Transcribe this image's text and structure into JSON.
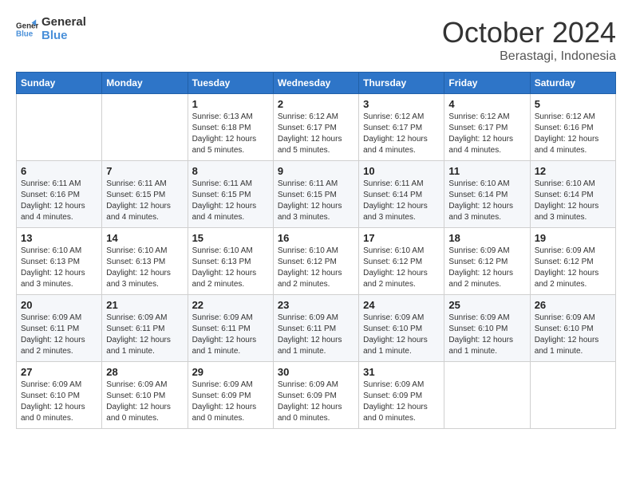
{
  "logo": {
    "line1": "General",
    "line2": "Blue"
  },
  "title": "October 2024",
  "location": "Berastagi, Indonesia",
  "days_of_week": [
    "Sunday",
    "Monday",
    "Tuesday",
    "Wednesday",
    "Thursday",
    "Friday",
    "Saturday"
  ],
  "weeks": [
    [
      {
        "day": "",
        "info": ""
      },
      {
        "day": "",
        "info": ""
      },
      {
        "day": "1",
        "info": "Sunrise: 6:13 AM\nSunset: 6:18 PM\nDaylight: 12 hours\nand 5 minutes."
      },
      {
        "day": "2",
        "info": "Sunrise: 6:12 AM\nSunset: 6:17 PM\nDaylight: 12 hours\nand 5 minutes."
      },
      {
        "day": "3",
        "info": "Sunrise: 6:12 AM\nSunset: 6:17 PM\nDaylight: 12 hours\nand 4 minutes."
      },
      {
        "day": "4",
        "info": "Sunrise: 6:12 AM\nSunset: 6:17 PM\nDaylight: 12 hours\nand 4 minutes."
      },
      {
        "day": "5",
        "info": "Sunrise: 6:12 AM\nSunset: 6:16 PM\nDaylight: 12 hours\nand 4 minutes."
      }
    ],
    [
      {
        "day": "6",
        "info": "Sunrise: 6:11 AM\nSunset: 6:16 PM\nDaylight: 12 hours\nand 4 minutes."
      },
      {
        "day": "7",
        "info": "Sunrise: 6:11 AM\nSunset: 6:15 PM\nDaylight: 12 hours\nand 4 minutes."
      },
      {
        "day": "8",
        "info": "Sunrise: 6:11 AM\nSunset: 6:15 PM\nDaylight: 12 hours\nand 4 minutes."
      },
      {
        "day": "9",
        "info": "Sunrise: 6:11 AM\nSunset: 6:15 PM\nDaylight: 12 hours\nand 3 minutes."
      },
      {
        "day": "10",
        "info": "Sunrise: 6:11 AM\nSunset: 6:14 PM\nDaylight: 12 hours\nand 3 minutes."
      },
      {
        "day": "11",
        "info": "Sunrise: 6:10 AM\nSunset: 6:14 PM\nDaylight: 12 hours\nand 3 minutes."
      },
      {
        "day": "12",
        "info": "Sunrise: 6:10 AM\nSunset: 6:14 PM\nDaylight: 12 hours\nand 3 minutes."
      }
    ],
    [
      {
        "day": "13",
        "info": "Sunrise: 6:10 AM\nSunset: 6:13 PM\nDaylight: 12 hours\nand 3 minutes."
      },
      {
        "day": "14",
        "info": "Sunrise: 6:10 AM\nSunset: 6:13 PM\nDaylight: 12 hours\nand 3 minutes."
      },
      {
        "day": "15",
        "info": "Sunrise: 6:10 AM\nSunset: 6:13 PM\nDaylight: 12 hours\nand 2 minutes."
      },
      {
        "day": "16",
        "info": "Sunrise: 6:10 AM\nSunset: 6:12 PM\nDaylight: 12 hours\nand 2 minutes."
      },
      {
        "day": "17",
        "info": "Sunrise: 6:10 AM\nSunset: 6:12 PM\nDaylight: 12 hours\nand 2 minutes."
      },
      {
        "day": "18",
        "info": "Sunrise: 6:09 AM\nSunset: 6:12 PM\nDaylight: 12 hours\nand 2 minutes."
      },
      {
        "day": "19",
        "info": "Sunrise: 6:09 AM\nSunset: 6:12 PM\nDaylight: 12 hours\nand 2 minutes."
      }
    ],
    [
      {
        "day": "20",
        "info": "Sunrise: 6:09 AM\nSunset: 6:11 PM\nDaylight: 12 hours\nand 2 minutes."
      },
      {
        "day": "21",
        "info": "Sunrise: 6:09 AM\nSunset: 6:11 PM\nDaylight: 12 hours\nand 1 minute."
      },
      {
        "day": "22",
        "info": "Sunrise: 6:09 AM\nSunset: 6:11 PM\nDaylight: 12 hours\nand 1 minute."
      },
      {
        "day": "23",
        "info": "Sunrise: 6:09 AM\nSunset: 6:11 PM\nDaylight: 12 hours\nand 1 minute."
      },
      {
        "day": "24",
        "info": "Sunrise: 6:09 AM\nSunset: 6:10 PM\nDaylight: 12 hours\nand 1 minute."
      },
      {
        "day": "25",
        "info": "Sunrise: 6:09 AM\nSunset: 6:10 PM\nDaylight: 12 hours\nand 1 minute."
      },
      {
        "day": "26",
        "info": "Sunrise: 6:09 AM\nSunset: 6:10 PM\nDaylight: 12 hours\nand 1 minute."
      }
    ],
    [
      {
        "day": "27",
        "info": "Sunrise: 6:09 AM\nSunset: 6:10 PM\nDaylight: 12 hours\nand 0 minutes."
      },
      {
        "day": "28",
        "info": "Sunrise: 6:09 AM\nSunset: 6:10 PM\nDaylight: 12 hours\nand 0 minutes."
      },
      {
        "day": "29",
        "info": "Sunrise: 6:09 AM\nSunset: 6:09 PM\nDaylight: 12 hours\nand 0 minutes."
      },
      {
        "day": "30",
        "info": "Sunrise: 6:09 AM\nSunset: 6:09 PM\nDaylight: 12 hours\nand 0 minutes."
      },
      {
        "day": "31",
        "info": "Sunrise: 6:09 AM\nSunset: 6:09 PM\nDaylight: 12 hours\nand 0 minutes."
      },
      {
        "day": "",
        "info": ""
      },
      {
        "day": "",
        "info": ""
      }
    ]
  ]
}
